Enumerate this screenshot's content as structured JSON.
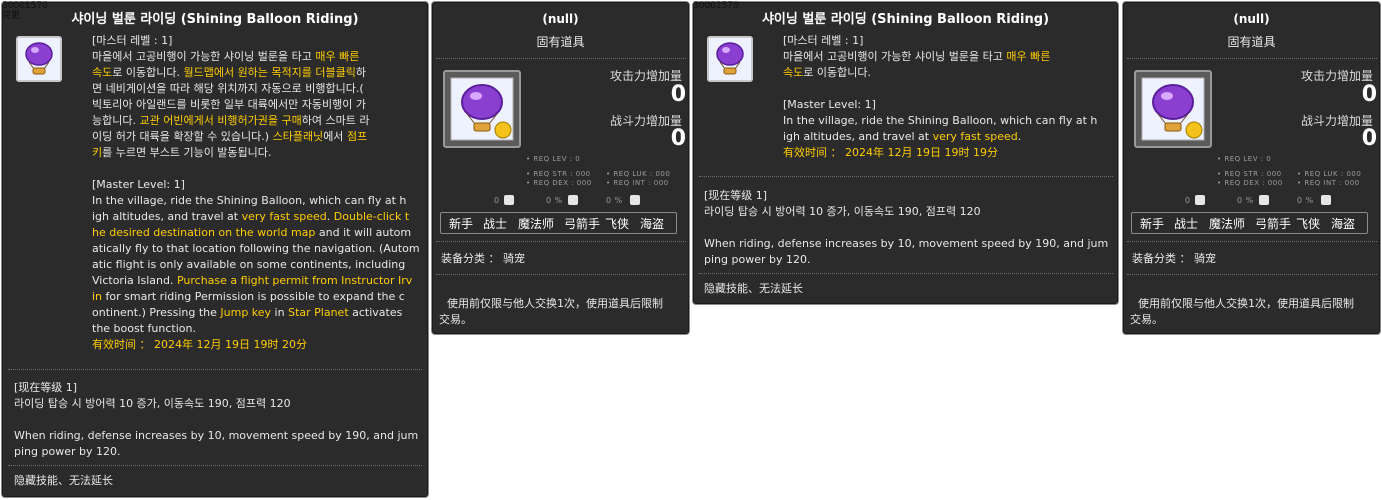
{
  "colors": {
    "panel_bg": "#2b2b2b",
    "highlight": "#ffcc00",
    "text": "#e8e8e8"
  },
  "tooltip_a": {
    "item_id": "30001570",
    "corner_text": "突更",
    "title": "샤이닝 벌룬 라이딩 (Shining Balloon Riding)",
    "desc_lines": [
      [
        {
          "t": "[마스터 레벨 : 1]"
        }
      ],
      [
        {
          "t": "마을에서 고공비행이 가능한 샤이닝 벌룬을 타고 "
        },
        {
          "t": "매우 빠른",
          "h": true
        }
      ],
      [
        {
          "t": "속도",
          "h": true
        },
        {
          "t": "로 이동합니다. "
        },
        {
          "t": "월드맵에서 원하는 목적지를 더블클릭",
          "h": true
        },
        {
          "t": "하"
        }
      ],
      [
        {
          "t": "면 네비게이션을 따라 해당 위치까지 자동으로 비행합니다.("
        }
      ],
      [
        {
          "t": "빅토리아 아일랜드를 비롯한 일부 대륙에서만 자동비행이 가"
        }
      ],
      [
        {
          "t": "능합니다. "
        },
        {
          "t": "교관 어빈에게서 비행허가권을 구매",
          "h": true
        },
        {
          "t": "하여 스마트 라"
        }
      ],
      [
        {
          "t": "이딩 허가 대륙을 확장할 수 있습니다.) "
        },
        {
          "t": "스타플래닛",
          "h": true
        },
        {
          "t": "에서 "
        },
        {
          "t": "점프",
          "h": true
        }
      ],
      [
        {
          "t": "키",
          "h": true
        },
        {
          "t": "를 누르면 부스트 기능이 발동됩니다."
        }
      ],
      [
        {
          "t": ""
        }
      ],
      [
        {
          "t": "[Master Level: 1]"
        }
      ],
      [
        {
          "t": "In the village, ride the Shining Balloon, which can fly at h"
        }
      ],
      [
        {
          "t": "igh altitudes, and travel at "
        },
        {
          "t": "very fast speed",
          "h": true
        },
        {
          "t": ". "
        },
        {
          "t": "Double-click t",
          "h": true
        }
      ],
      [
        {
          "t": "he desired destination on the world map",
          "h": true
        },
        {
          "t": " and it will autom"
        }
      ],
      [
        {
          "t": "atically fly to that location following the navigation. (Autom"
        }
      ],
      [
        {
          "t": "atic flight is only available on some continents, including"
        }
      ],
      [
        {
          "t": "Victoria Island. "
        },
        {
          "t": "Purchase a flight permit from Instructor Irv",
          "h": true
        }
      ],
      [
        {
          "t": "in",
          "h": true
        },
        {
          "t": " for smart riding Permission is possible to expand the c"
        }
      ],
      [
        {
          "t": "ontinent.) Pressing the "
        },
        {
          "t": "Jump key",
          "h": true
        },
        {
          "t": " in "
        },
        {
          "t": "Star Planet",
          "h": true
        },
        {
          "t": " activates"
        }
      ],
      [
        {
          "t": "the boost function."
        }
      ],
      [
        {
          "t": "有效时间 ： 2024年 12月 19日 19时 20分",
          "h": true
        }
      ]
    ],
    "level_header": "[现在等级 1]",
    "level_kr": "라이딩 탑승 시 방어력 10 증가, 이동속도 190, 점프력 120",
    "level_en_1": "When riding, defense increases by 10, movement speed by 190, and jum",
    "level_en_2": "ping power by 120.",
    "footer": "隐藏技能、无法延长"
  },
  "item_a": {
    "title": "(null)",
    "subtitle": "固有道具",
    "attack_label": "攻击力增加量",
    "attack_value": "0",
    "power_label": "战斗力增加量",
    "power_value": "0",
    "req_lev": "• REQ LEV :     0",
    "req_str": "• REQ STR : 000",
    "req_luk": "• REQ LUK : 000",
    "req_dex": "• REQ DEX : 000",
    "req_int": "• REQ INT : 000",
    "pct1": "0",
    "pct2": "0 %",
    "pct3": "0 %",
    "jobs": [
      "新手",
      "战士",
      "魔法师",
      "弓箭手",
      "飞侠",
      "海盗"
    ],
    "category": "装备分类 ： 骑宠",
    "note_1": "使用前仅限与他人交换1次，使用道具后限制",
    "note_2": "交易。"
  },
  "tooltip_b": {
    "item_id": "30001570",
    "title": "샤이닝 벌룬 라이딩 (Shining Balloon Riding)",
    "desc_lines": [
      [
        {
          "t": "[마스터 레벨 : 1]"
        }
      ],
      [
        {
          "t": "마을에서 고공비행이 가능한 샤이닝 벌룬을 타고 "
        },
        {
          "t": "매우 빠른",
          "h": true
        }
      ],
      [
        {
          "t": "속도",
          "h": true
        },
        {
          "t": "로 이동합니다."
        }
      ],
      [
        {
          "t": ""
        }
      ],
      [
        {
          "t": "[Master Level: 1]"
        }
      ],
      [
        {
          "t": "In the village, ride the Shining Balloon, which can fly at h"
        }
      ],
      [
        {
          "t": "igh altitudes, and travel at "
        },
        {
          "t": "very fast speed",
          "h": true
        },
        {
          "t": "."
        }
      ],
      [
        {
          "t": "有效时间 ： 2024年 12月 19日 19时 19分",
          "h": true
        }
      ]
    ],
    "level_header": "[现在等级 1]",
    "level_kr": "라이딩 탑승 시 방어력 10 증가, 이동속도 190, 점프력 120",
    "level_en_1": "When riding, defense increases by 10, movement speed by 190, and jum",
    "level_en_2": "ping power by 120.",
    "footer": "隐藏技能、无法延长"
  },
  "item_b": {
    "title": "(null)",
    "subtitle": "固有道具",
    "attack_label": "攻击力增加量",
    "attack_value": "0",
    "power_label": "战斗力增加量",
    "power_value": "0",
    "req_lev": "• REQ LEV :     0",
    "req_str": "• REQ STR : 000",
    "req_luk": "• REQ LUK : 000",
    "req_dex": "• REQ DEX : 000",
    "req_int": "• REQ INT : 000",
    "pct1": "0",
    "pct2": "0 %",
    "pct3": "0 %",
    "jobs": [
      "新手",
      "战士",
      "魔法师",
      "弓箭手",
      "飞侠",
      "海盗"
    ],
    "category": "装备分类 ： 骑宠",
    "note_1": "使用前仅限与他人交换1次，使用道具后限制",
    "note_2": "交易。"
  }
}
